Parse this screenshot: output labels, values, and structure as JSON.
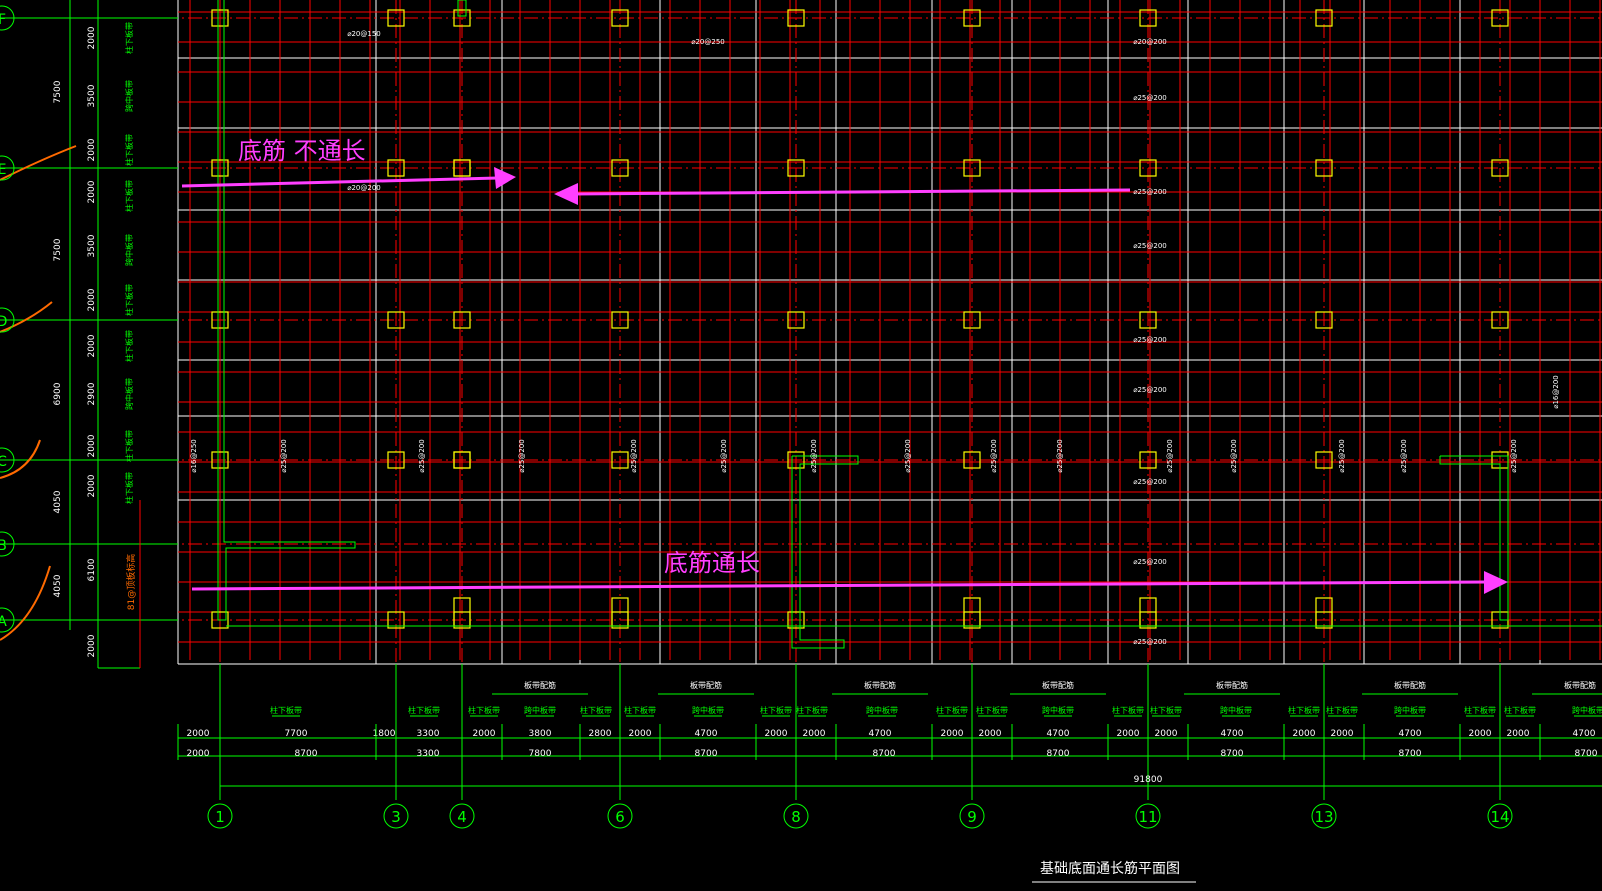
{
  "drawing": {
    "title": "基础底面通长筋平面图",
    "annotations": {
      "not_continuous": "底筋  不通长",
      "continuous": "底筋通长"
    },
    "colors": {
      "background": "#000000",
      "axis_green": "#00ff00",
      "rebar_red": "#ff0000",
      "grid_white": "#ffffff",
      "column_yellow": "#ffff00",
      "arrow_magenta": "#ff3fff",
      "curve_orange": "#ff6a00"
    }
  },
  "axes": {
    "vertical": [
      "1",
      "3",
      "4",
      "6",
      "8",
      "9",
      "11",
      "13",
      "14"
    ],
    "horizontal": [
      "F",
      "E",
      "D",
      "C",
      "B",
      "A"
    ]
  },
  "dims_row1": [
    "2000",
    "7700",
    "1800",
    "3300",
    "2000",
    "3800",
    "2800",
    "2000",
    "4700",
    "2000",
    "2000",
    "4700",
    "2000",
    "2000",
    "4700",
    "2000",
    "2000",
    "4700",
    "2000",
    "2000",
    "4700",
    "2000",
    "2000",
    "4700"
  ],
  "dims_row2": [
    "2000",
    "8700",
    "3300",
    "7800",
    "8700",
    "8700",
    "8700",
    "8700",
    "8700",
    "8700"
  ],
  "dims_total": "91800",
  "left_dims_outer": [
    "7500",
    "7500",
    "6900",
    "4050",
    "4050"
  ],
  "left_dims_inner": [
    "2000",
    "3500",
    "2000",
    "2000",
    "3500",
    "2000",
    "2000",
    "2900",
    "2000",
    "2000",
    "6100",
    "2000"
  ],
  "bottom_labels": {
    "col": "柱下板带",
    "span": "跨中板带",
    "strip": "柱下板带",
    "group": "板带配筋"
  },
  "left_labels": {
    "col": "柱下板带",
    "span": "跨中板带",
    "elev": "81@顶板标高"
  },
  "rebar_h": [
    "⌀20@150",
    "⌀20@250",
    "⌀20@200",
    "⌀25@200",
    "⌀25@200",
    "⌀20@200",
    "⌀25@200",
    "⌀25@200",
    "⌀25@200",
    "⌀25@200",
    "⌀25@200",
    "⌀25@200",
    "⌀16@250"
  ],
  "rebar_v": [
    "⌀16@250",
    "⌀25@200",
    "⌀25@200",
    "⌀25@200",
    "⌀25@200",
    "⌀25@200",
    "⌀25@200",
    "⌀25@200",
    "⌀25@200",
    "⌀25@200",
    "⌀25@200",
    "⌀25@200",
    "⌀25@200",
    "⌀25@200",
    "⌀25@200",
    "⌀16@200"
  ]
}
